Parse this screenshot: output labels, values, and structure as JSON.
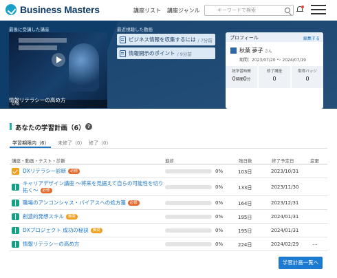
{
  "header": {
    "logo_text": "Business Masters",
    "nav": [
      "講座リスト",
      "講座ジャンル"
    ],
    "search_placeholder": "キーワードで検索"
  },
  "hero": {
    "last_viewed_title": "最後に受講した講座",
    "thumbnail_progress": "0%",
    "thumbnail_title": "情報リテラシーの高め方",
    "recent_title": "最近視聴した動画",
    "recent_items": [
      {
        "label": "ビジネス情報を収集するには",
        "meta": "/ 7分前"
      },
      {
        "label": "情報開示のポイント",
        "meta": "/ 9分前"
      }
    ]
  },
  "profile": {
    "title": "プロフィール",
    "edit_label": "編集する",
    "name": "秋葉 夢子",
    "name_suffix": "さん",
    "period": "期間：2023/07/20 ～ 2024/07/19",
    "stats": [
      {
        "label": "総学習時間",
        "value": "0",
        "unit1": "時間",
        "value2": "0",
        "unit2": "分"
      },
      {
        "label": "修了講座",
        "value": "0"
      },
      {
        "label": "取得バッジ",
        "value": "0"
      }
    ]
  },
  "plan": {
    "title": "あなたの学習計画（6）",
    "tabs": [
      "学習期限内（6）",
      "未修了（0）",
      "修了（0）"
    ],
    "columns": [
      "講座・動画・テスト・診断",
      "進捗",
      "残日数",
      "終了予定日",
      "変更"
    ],
    "rows": [
      {
        "icon": "check",
        "title": "DXリテラシー診断",
        "badge": "必修",
        "badge_type": "req",
        "progress": 0,
        "progress_text": "0%",
        "days": "103日",
        "due": "2023/10/31",
        "more": ""
      },
      {
        "icon": "book",
        "title": "キャリアデザイン講座 ～将来を見据えて自らの可能性を切り拓く～",
        "badge": "必修",
        "badge_type": "req",
        "progress": 0,
        "progress_text": "0%",
        "days": "133日",
        "due": "2023/11/30",
        "more": ""
      },
      {
        "icon": "book",
        "title": "職場のアンコンシャス・バイアスへの処方箋",
        "badge": "必修",
        "badge_type": "req",
        "progress": 0,
        "progress_text": "0%",
        "days": "164日",
        "due": "2023/12/31",
        "more": ""
      },
      {
        "icon": "book",
        "title": "創造的発想スキル",
        "badge": "推奨",
        "badge_type": "rec",
        "progress": 0,
        "progress_text": "0%",
        "days": "195日",
        "due": "2024/01/31",
        "more": ""
      },
      {
        "icon": "book",
        "title": "DXプロジェクト 成功の秘訣",
        "badge": "推奨",
        "badge_type": "rec",
        "progress": 0,
        "progress_text": "0%",
        "days": "195日",
        "due": "2024/01/31",
        "more": ""
      },
      {
        "icon": "book",
        "title": "情報リテラシーの高め方",
        "badge": "",
        "badge_type": "",
        "progress": 0,
        "progress_text": "0%",
        "days": "224日",
        "due": "2024/02/29",
        "more": "…"
      }
    ],
    "list_button": "学習計画一覧へ"
  }
}
